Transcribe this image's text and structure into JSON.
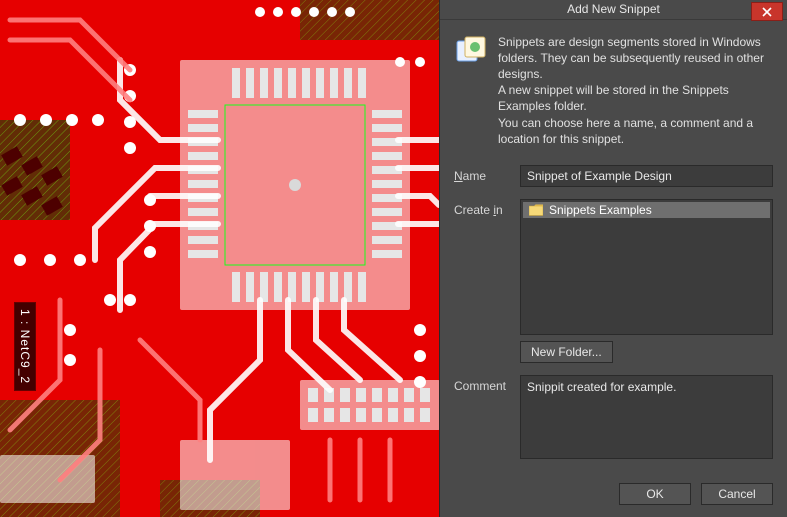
{
  "dialog": {
    "title": "Add New Snippet",
    "intro": {
      "line1": "Snippets are design segments stored in Windows folders. They can be subsequently reused in other designs.",
      "line2": "A new snippet will be stored in the Snippets Examples folder.",
      "line3": "You can choose here a name, a comment and a location for this snippet."
    },
    "labels": {
      "name_pre": "N",
      "name_post": "ame",
      "createin_pre": "Create ",
      "createin_post": "i",
      "createin_post2": "n",
      "comment": "Comment",
      "new_folder_pre": "Ne",
      "new_folder_u": "w",
      "new_folder_post": " Folder..."
    },
    "fields": {
      "name_value": "Snippet of Example Design",
      "comment_value": "Snippit created for example."
    },
    "tree": {
      "root_item": "Snippets Examples"
    },
    "buttons": {
      "ok": "OK",
      "cancel": "Cancel"
    }
  },
  "pcb": {
    "net_label": "1 : NetC9_2"
  }
}
